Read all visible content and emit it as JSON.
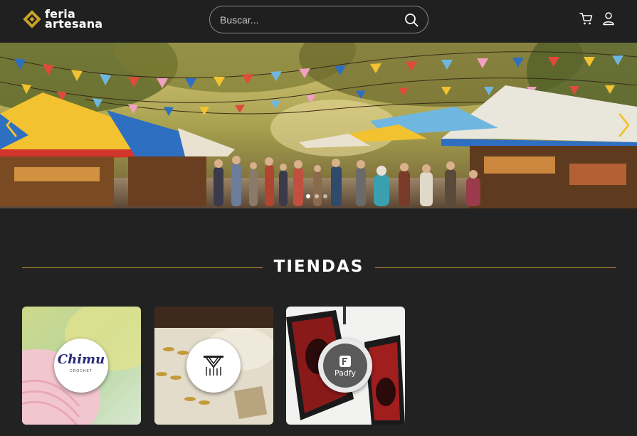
{
  "header": {
    "logo_line1": "feria",
    "logo_line2": "artesana",
    "search_placeholder": "Buscar...",
    "accent_color": "#c9a227"
  },
  "hero": {
    "slides_count": 3,
    "active_slide": 1
  },
  "section": {
    "title": "TIENDAS"
  },
  "stores": [
    {
      "name": "Chimu",
      "logo_text": "Chimu",
      "logo_sub": "CROCHET",
      "icon": "yarn-image"
    },
    {
      "name": "macrame-store",
      "icon": "macrame-logo"
    },
    {
      "name": "Padfy",
      "logo_text": "Padfy",
      "icon": "mousepad-image"
    }
  ]
}
